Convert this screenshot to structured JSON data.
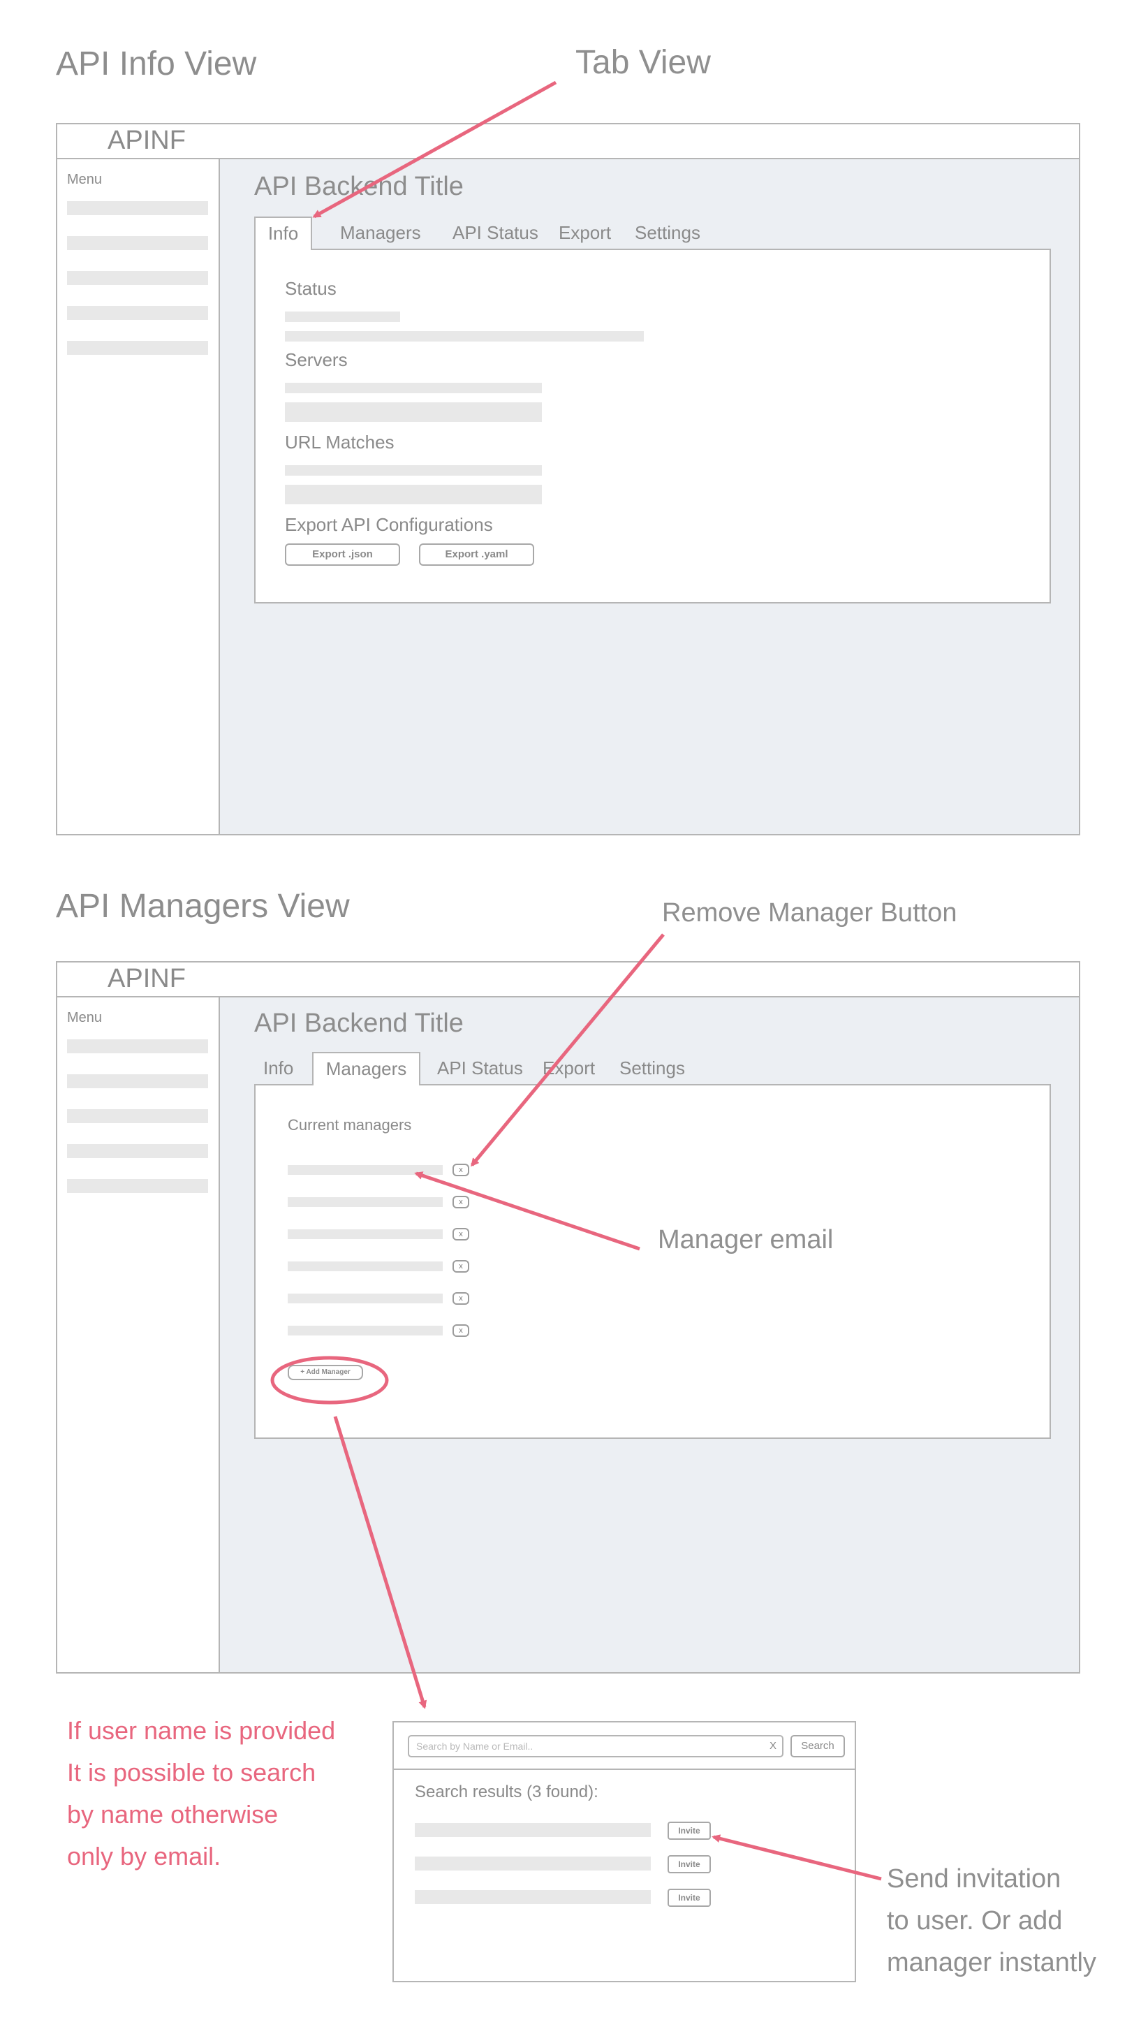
{
  "info_view": {
    "heading": "API Info View",
    "app_title": "APINF",
    "menu_label": "Menu",
    "page_title": "API Backend Title",
    "tabs": [
      "Info",
      "Managers",
      "API Status",
      "Export",
      "Settings"
    ],
    "active_tab": "Info",
    "sections": {
      "status": "Status",
      "servers": "Servers",
      "url_matches": "URL Matches",
      "export": "Export API Configurations"
    },
    "export_json_label": "Export .json",
    "export_yaml_label": "Export .yaml"
  },
  "managers_view": {
    "heading": "API Managers View",
    "app_title": "APINF",
    "menu_label": "Menu",
    "page_title": "API Backend Title",
    "tabs": [
      "Info",
      "Managers",
      "API Status",
      "Export",
      "Settings"
    ],
    "active_tab": "Managers",
    "current_managers_label": "Current managers",
    "remove_label": "x",
    "add_manager_label": "+ Add Manager"
  },
  "search_popup": {
    "placeholder": "Search by Name or Email..",
    "clear_label": "X",
    "search_label": "Search",
    "results_label": "Search results (3 found):",
    "invite_label": "Invite"
  },
  "annotations": {
    "tab_view": "Tab View",
    "remove_manager_button": "Remove Manager Button",
    "manager_email": "Manager email",
    "search_note": [
      "If user name is provided",
      "It is possible to search",
      "by name otherwise",
      "only by email."
    ],
    "invite_note": [
      "Send invitation",
      "to user. Or add",
      "manager instantly"
    ]
  },
  "colors": {
    "annotation_arrow": "#e8667e",
    "main_background": "#eceff3",
    "skeleton": "#e8e8e8"
  }
}
